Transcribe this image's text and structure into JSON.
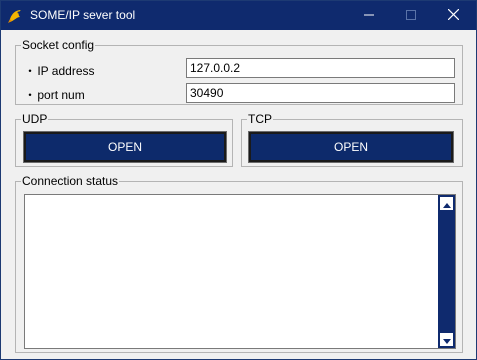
{
  "window": {
    "title": "SOME/IP sever tool",
    "controls": [
      "minimize",
      "maximize",
      "close"
    ]
  },
  "socket_config": {
    "legend": "Socket config",
    "ip_label": "IP address",
    "ip_value": "127.0.0.2",
    "port_label": "port num",
    "port_value": "30490",
    "bullet": "・"
  },
  "udp": {
    "legend": "UDP",
    "button_label": "OPEN"
  },
  "tcp": {
    "legend": "TCP",
    "button_label": "OPEN"
  },
  "connection_status": {
    "legend": "Connection status",
    "text": ""
  },
  "colors": {
    "titlebar": "#0f2a6e",
    "button": "#0d2a6b",
    "window_bg": "#f0f0f0"
  },
  "icons": {
    "app": "bird-icon",
    "minimize": "minimize-icon",
    "maximize": "maximize-icon",
    "close": "close-icon",
    "scroll_up": "arrow-up-icon",
    "scroll_down": "arrow-down-icon"
  }
}
